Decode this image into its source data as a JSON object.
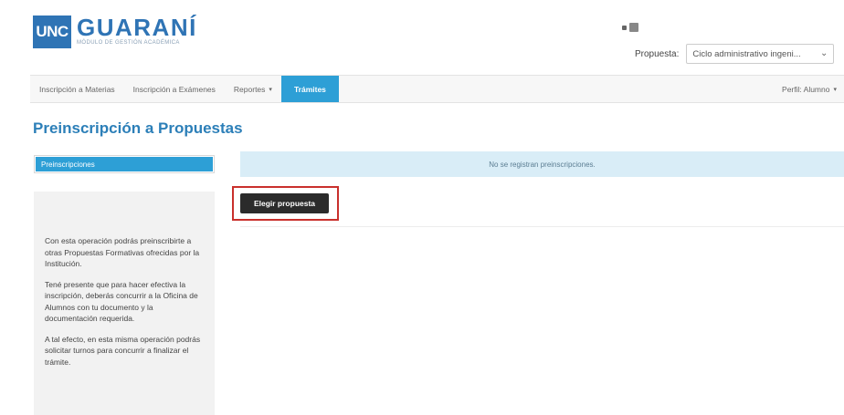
{
  "header": {
    "logo_box": "UNC",
    "logo_title": "GUARANÍ",
    "logo_subtitle": "MÓDULO DE GESTIÓN ACADÉMICA",
    "propuesta_label": "Propuesta:",
    "propuesta_value": "Ciclo administrativo ingeni..."
  },
  "nav": {
    "items": [
      {
        "label": "Inscripción a Materias"
      },
      {
        "label": "Inscripción a Exámenes"
      },
      {
        "label": "Reportes",
        "dropdown": true
      },
      {
        "label": "Trámites",
        "active": true
      }
    ],
    "perfil": "Perfil: Alumno"
  },
  "page": {
    "title": "Preinscripción a Propuestas"
  },
  "sidebar": {
    "tab_label": "Preinscripciones",
    "info": [
      "Con esta operación podrás preinscribirte a otras Propuestas Formativas ofrecidas por la Institución.",
      "Tené presente que para hacer efectiva la inscripción, deberás concurrir a la Oficina de Alumnos con tu documento y la documentación requerida.",
      "A tal efecto, en esta misma operación podrás solicitar turnos para concurrir a finalizar el trámite."
    ]
  },
  "main": {
    "alert_text": "No se registran preinscripciones.",
    "button_label": "Elegir propuesta"
  },
  "icons": {
    "nav_caret": "▾",
    "select_chevron": "⌄"
  },
  "colors": {
    "brand_blue": "#2f74b5",
    "active_tab": "#2d9fd6",
    "title_blue": "#2c7fb8",
    "alert_bg": "#d9edf7",
    "button_bg": "#2b2b2b",
    "highlight_red": "#c9302c"
  }
}
